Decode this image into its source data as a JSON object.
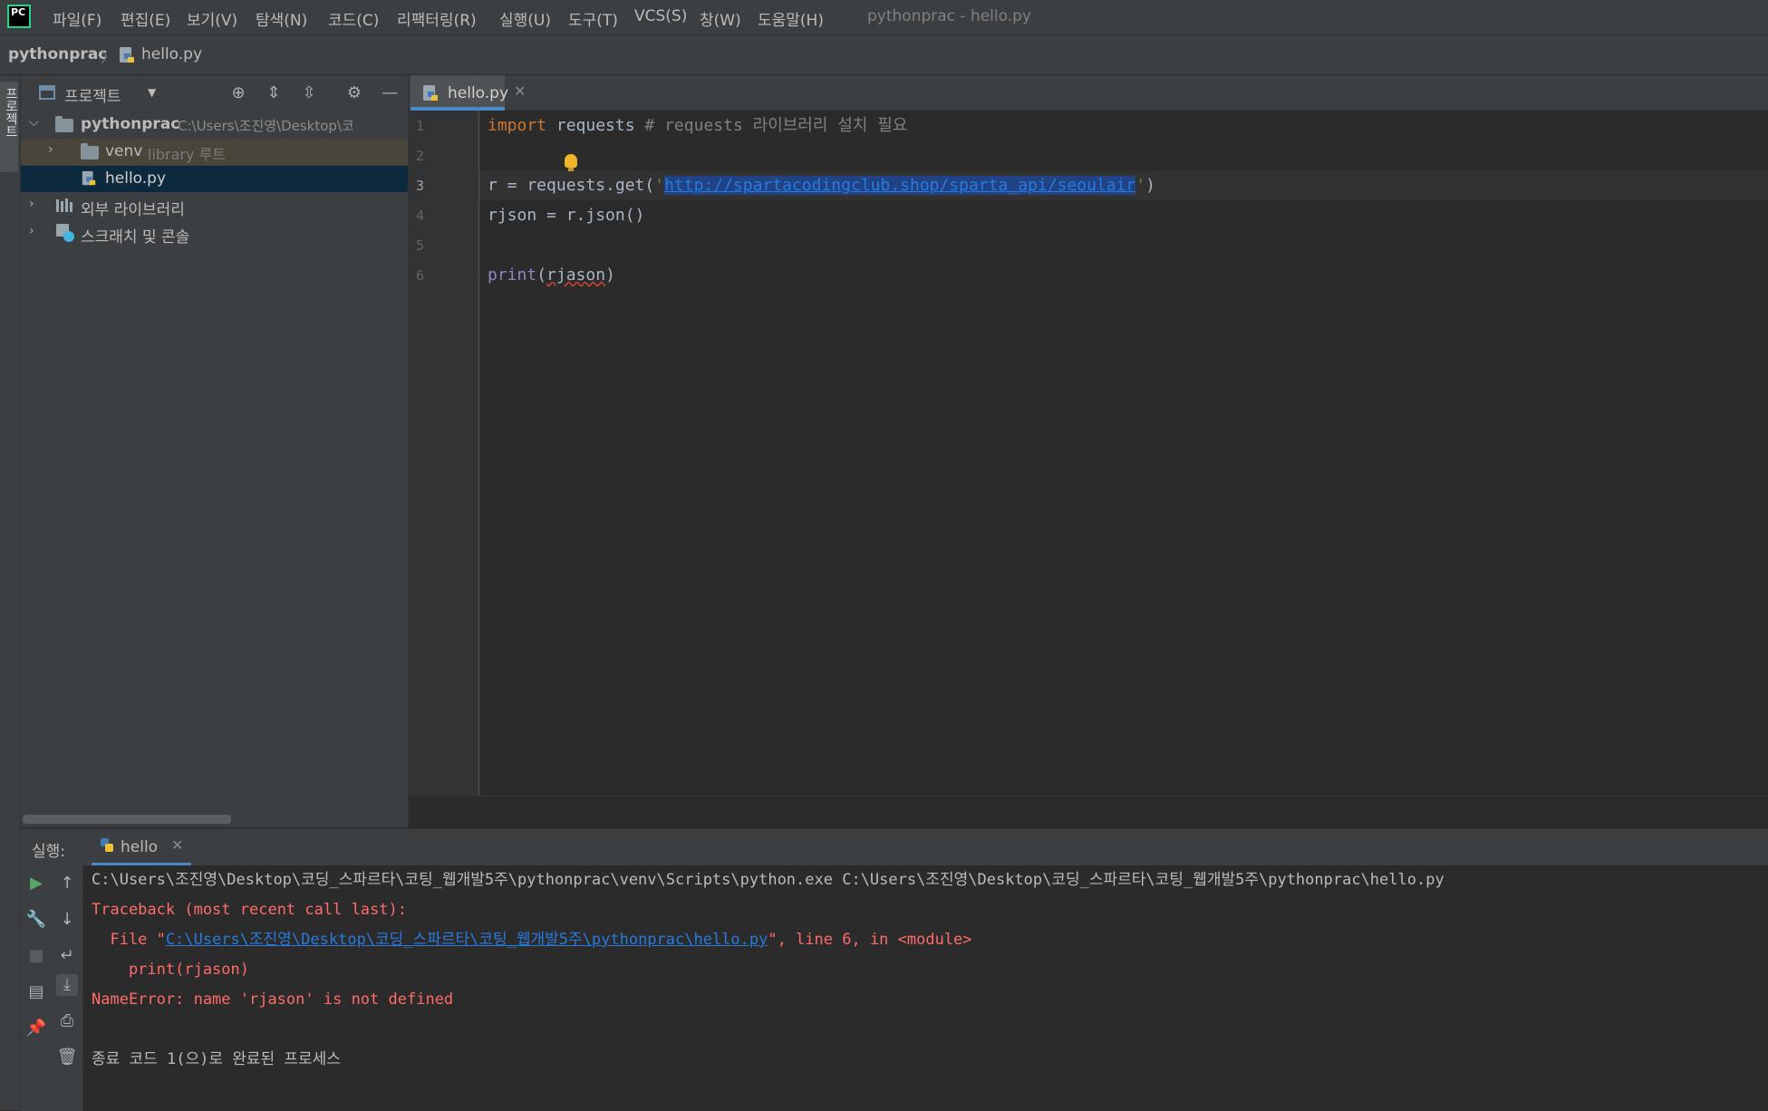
{
  "menubar": {
    "logo_text": "PC",
    "items": [
      "파일(F)",
      "편집(E)",
      "보기(V)",
      "탐색(N)",
      "코드(C)",
      "리팩터링(R)",
      "실행(U)",
      "도구(T)",
      "VCS(S)",
      "창(W)",
      "도움말(H)"
    ],
    "window_title": "pythonprac - hello.py"
  },
  "breadcrumb": {
    "project": "pythonprac",
    "separator": "〉",
    "file": "hello.py"
  },
  "tool_stripe": {
    "project_tab_label": "프로젝트"
  },
  "project_panel": {
    "title": "프로젝트",
    "tree": {
      "root_name": "pythonprac",
      "root_path": "C:\\Users\\조진영\\Desktop\\코",
      "venv_name": "venv",
      "venv_tag": "library 루트",
      "file_name": "hello.py",
      "external_libraries": "외부 라이브러리",
      "scratches": "스크래치 및 콘솔"
    }
  },
  "editor": {
    "tab_label": "hello.py",
    "line_numbers": [
      "1",
      "2",
      "3",
      "4",
      "5",
      "6"
    ],
    "code": {
      "l1_kw": "import",
      "l1_mod": " requests",
      "l1_comment": "# requests 라이브러리 설치 필요",
      "l3_pre": "r = requests.get(",
      "l3_quote_open": "'",
      "l3_url": "http://spartacodingclub.shop/sparta_api/seoulair",
      "l3_quote_close": "'",
      "l3_post": ")",
      "l4": "rjson = r.json()",
      "l6_builtin": "print",
      "l6_open": "(",
      "l6_arg": "rjason",
      "l6_close": ")"
    }
  },
  "run_panel": {
    "label": "실행:",
    "tab_label": "hello",
    "console": {
      "command": "C:\\Users\\조진영\\Desktop\\코딩_스파르타\\코팅_웹개발5주\\pythonprac\\venv\\Scripts\\python.exe C:\\Users\\조진영\\Desktop\\코딩_스파르타\\코팅_웹개발5주\\pythonprac\\hello.py",
      "traceback_header": "Traceback (most recent call last):",
      "file_prefix": "  File \"",
      "file_link": "C:\\Users\\조진영\\Desktop\\코딩_스파르타\\코팅_웹개발5주\\pythonprac\\hello.py",
      "file_suffix": "\", line 6, in <module>",
      "code_line": "    print(rjason)",
      "error": "NameError: name 'rjason' is not defined",
      "exit": "종료 코드 1(으)로 완료된 프로세스"
    }
  },
  "colors": {
    "background": "#2b2b2b",
    "panel": "#3c3f41",
    "keyword": "#cc7832",
    "string": "#6a8759",
    "link": "#287bde",
    "error_text": "#ff6b68",
    "selection_row": "#0d293e"
  }
}
